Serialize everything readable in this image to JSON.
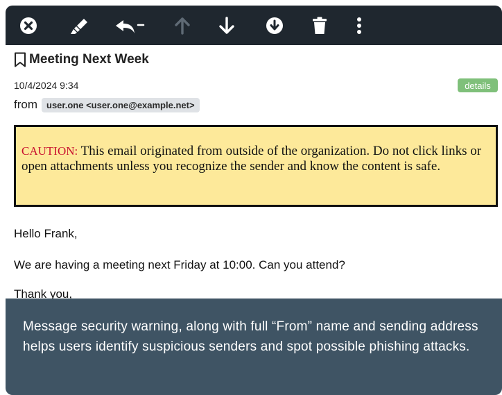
{
  "toolbar": {
    "buttons": [
      {
        "name": "close-button",
        "icon": "close-circle-icon"
      },
      {
        "name": "edit-button",
        "icon": "highlighter-icon"
      },
      {
        "name": "reply-button",
        "icon": "reply-dropdown-icon"
      },
      {
        "name": "previous-button",
        "icon": "arrow-up-icon"
      },
      {
        "name": "next-button",
        "icon": "arrow-down-icon"
      },
      {
        "name": "download-button",
        "icon": "download-circle-icon"
      },
      {
        "name": "delete-button",
        "icon": "trash-icon"
      },
      {
        "name": "more-button",
        "icon": "vertical-dots-icon"
      }
    ]
  },
  "message": {
    "subject": "Meeting Next Week",
    "date": "10/4/2024 9:34",
    "details_label": "details",
    "from_label": "from",
    "from_address": "user.one <user.one@example.net>",
    "caution_lead": "CAUTION:",
    "caution_text": " This email originated from outside of the organization. Do not click links or open attachments unless you recognize the sender and know the content is safe.",
    "greeting": "Hello Frank,",
    "body": "We are having a meeting next Friday at 10:00. Can you attend?",
    "signoff": "Thank you,"
  },
  "caption": {
    "text": "Message security warning, along with full “From” name and sending address helps users identify suspicious senders and spot possible phishing attacks."
  },
  "colors": {
    "toolbar_bg": "#1f272f",
    "caution_bg": "#fde99a",
    "caution_lead": "#c8102e",
    "details_bg": "#7fc07a",
    "caption_bg": "#3f5464"
  }
}
